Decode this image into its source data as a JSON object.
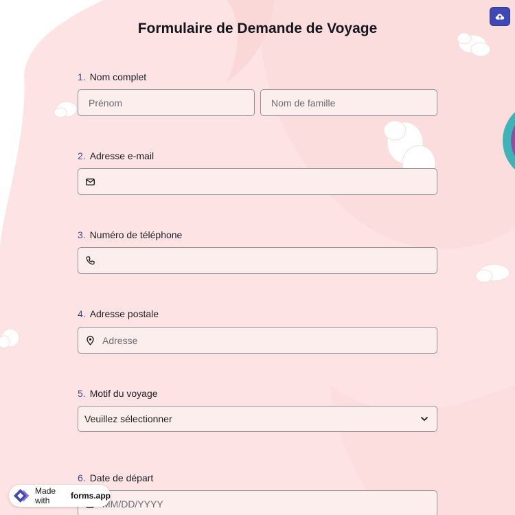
{
  "form": {
    "title": "Formulaire de Demande de Voyage"
  },
  "header": {
    "upload_icon": "cloud-upload-icon"
  },
  "questions": [
    {
      "number": "1.",
      "label": "Nom complet",
      "first_placeholder": "Prénom",
      "last_placeholder": "Nom de famille"
    },
    {
      "number": "2.",
      "label": "Adresse e-mail",
      "icon": "envelope-icon",
      "placeholder": ""
    },
    {
      "number": "3.",
      "label": "Numéro de téléphone",
      "icon": "phone-icon",
      "placeholder": ""
    },
    {
      "number": "4.",
      "label": "Adresse postale",
      "icon": "map-pin-icon",
      "placeholder": "Adresse"
    },
    {
      "number": "5.",
      "label": "Motif du voyage",
      "selected": "Veuillez sélectionner",
      "icon": "chevron-down-icon"
    },
    {
      "number": "6.",
      "label": "Date de départ",
      "icon": "calendar-icon",
      "placeholder": "MM/DD/YYYY"
    }
  ],
  "badge": {
    "prefix": "Made with",
    "brand": "forms.app"
  },
  "colors": {
    "background_pink": "#fde3e3",
    "field_fill": "#fdeeee",
    "accent_button": "#3f48b4",
    "number_color": "#3b4a8e"
  }
}
